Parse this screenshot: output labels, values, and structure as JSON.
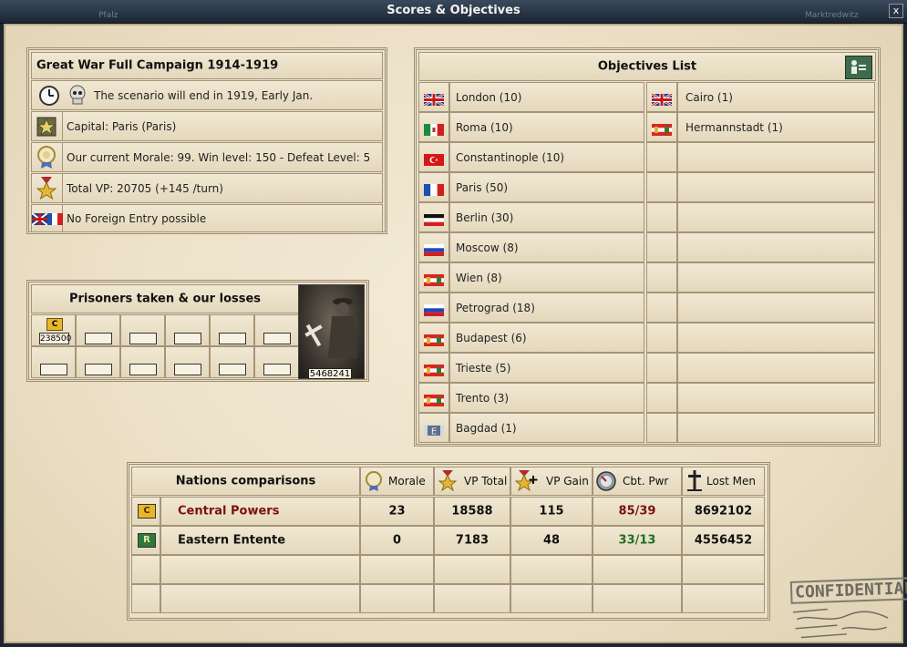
{
  "window": {
    "title": "Scores & Objectives",
    "ghost_left": "Pfalz",
    "ghost_right": "Marktredwitz",
    "close_label": "x"
  },
  "campaign": {
    "title": "Great War Full Campaign 1914-1919",
    "rows": [
      {
        "icon": "clock-skull-icon",
        "text": "The scenario will end in 1919, Early Jan."
      },
      {
        "icon": "capital-star-icon",
        "text": "Capital: Paris (Paris)"
      },
      {
        "icon": "morale-medal-icon",
        "text": "Our current Morale: 99. Win level: 150 - Defeat Level: 5"
      },
      {
        "icon": "vp-medal-icon",
        "text": "Total VP: 20705 (+145 /turn)"
      },
      {
        "icon": "flags-icon",
        "text": "No Foreign Entry possible"
      }
    ]
  },
  "prisoners": {
    "title": "Prisoners taken & our losses",
    "taken_value": "238500",
    "losses_value": "5468241"
  },
  "objectives": {
    "title": "Objectives List",
    "left": [
      {
        "flag": "uk",
        "label": "London (10)"
      },
      {
        "flag": "italy",
        "label": "Roma (10)"
      },
      {
        "flag": "ottoman",
        "label": "Constantinople (10)"
      },
      {
        "flag": "france",
        "label": "Paris (50)"
      },
      {
        "flag": "germany",
        "label": "Berlin (30)"
      },
      {
        "flag": "russia",
        "label": "Moscow (8)"
      },
      {
        "flag": "austria",
        "label": "Wien (8)"
      },
      {
        "flag": "russia",
        "label": "Petrograd (18)"
      },
      {
        "flag": "austria",
        "label": "Budapest (6)"
      },
      {
        "flag": "austria",
        "label": "Trieste (5)"
      },
      {
        "flag": "austria",
        "label": "Trento (3)"
      },
      {
        "flag": "ottoman-e",
        "label": "Bagdad (1)"
      }
    ],
    "right": [
      {
        "flag": "uk",
        "label": "Cairo (1)"
      },
      {
        "flag": "austria",
        "label": "Hermannstadt (1)"
      }
    ]
  },
  "comparisons": {
    "title": "Nations comparisons",
    "columns": [
      "Morale",
      "VP Total",
      "VP Gain",
      "Cbt. Pwr",
      "Lost Men"
    ],
    "rows": [
      {
        "badge": "C",
        "name": "Central Powers",
        "morale": "23",
        "vp_total": "18588",
        "vp_gain": "115",
        "cbt_pwr": "85/39",
        "lost_men": "8692102"
      },
      {
        "badge": "R",
        "name": "Eastern Entente",
        "morale": "0",
        "vp_total": "7183",
        "vp_gain": "48",
        "cbt_pwr": "33/13",
        "lost_men": "4556452"
      }
    ]
  },
  "stamp": {
    "text": "CONFIDENTIAL"
  },
  "colors": {
    "central_powers": "#7a1111",
    "eastern_entente_pwr": "#1f6e1f",
    "paper": "#ece1c8",
    "border": "#9e8d71"
  }
}
